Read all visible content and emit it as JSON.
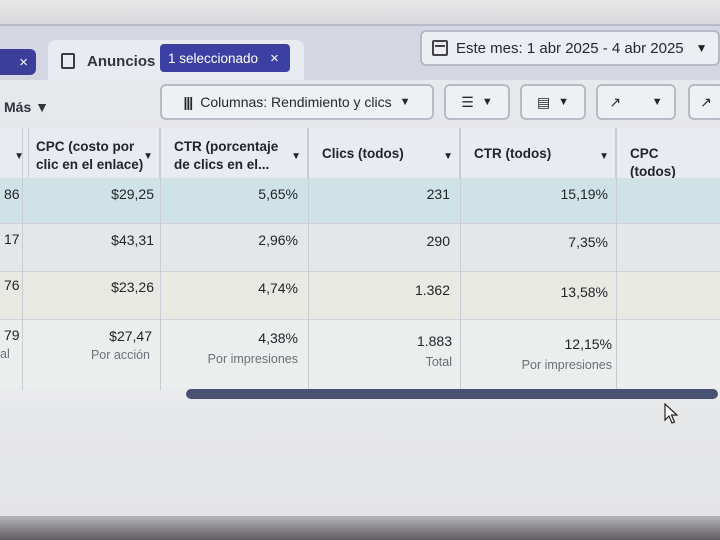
{
  "tabs": {
    "closed_tab_close": "×",
    "active_label": "Anuncios",
    "selected_chip": "1 seleccionado",
    "chip_close": "×"
  },
  "date_range": {
    "label": "Este mes: 1 abr 2025 - 4 abr 2025",
    "caret": "▼"
  },
  "toolbar": {
    "more_label": "Más ▼",
    "columns_icon": "|||",
    "columns_label": "Columnas: Rendimiento y clics",
    "caret": "▼",
    "breakdown_icon": "☰",
    "reports_icon": "▤",
    "export_icon": "↗",
    "chart_icon": "↗"
  },
  "table": {
    "headers": [
      {
        "label": "",
        "id": "prev"
      },
      {
        "label": "CPC (costo por clic en el enlace)",
        "id": "cpc-link"
      },
      {
        "label": "CTR (porcentaje de clics en el...",
        "id": "ctr-link"
      },
      {
        "label": "Clics (todos)",
        "id": "clicks-all"
      },
      {
        "label": "CTR (todos)",
        "id": "ctr-all"
      },
      {
        "label": "CPC (todos)",
        "id": "cpc-all"
      }
    ],
    "rows": [
      {
        "prev": "86",
        "cpc_link": "$29,25",
        "ctr_link": "5,65%",
        "clicks_all": "231",
        "ctr_all": "15,19%"
      },
      {
        "prev": "17",
        "cpc_link": "$43,31",
        "ctr_link": "2,96%",
        "clicks_all": "290",
        "ctr_all": "7,35%"
      },
      {
        "prev": "76",
        "cpc_link": "$23,26",
        "ctr_link": "4,74%",
        "clicks_all": "1.362",
        "ctr_all": "13,58%"
      }
    ],
    "totals": {
      "prev": "79",
      "prev_sub": "al",
      "cpc_link": "$27,47",
      "cpc_link_sub": "Por acción",
      "ctr_link": "4,38%",
      "ctr_link_sub": "Por impresiones",
      "clicks_all": "1.883",
      "clicks_all_sub": "Total",
      "ctr_all": "12,15%",
      "ctr_all_sub": "Por impresiones"
    }
  },
  "colors": {
    "accent": "#3d40a3",
    "row_highlight": "#cfe3e6",
    "scrollbar": "#4a5274"
  }
}
